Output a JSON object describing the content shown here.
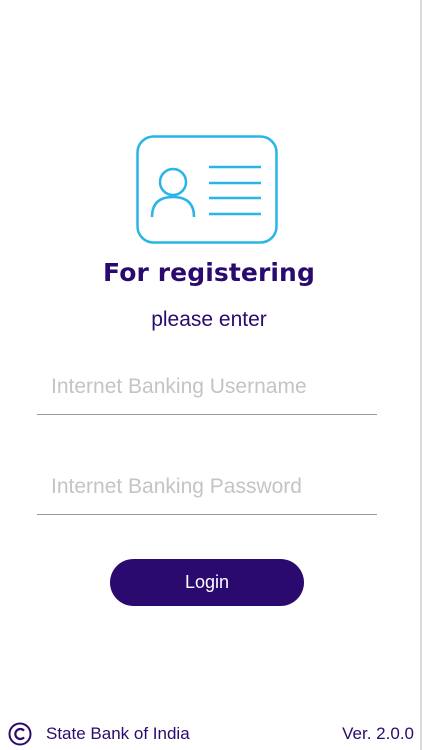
{
  "header": {
    "title": "For registering",
    "subtitle": "please enter"
  },
  "form": {
    "username_placeholder": "Internet Banking Username",
    "password_placeholder": "Internet Banking Password",
    "login_label": "Login"
  },
  "footer": {
    "bank_name": "State Bank of India",
    "version": "Ver. 2.0.0"
  },
  "icons": {
    "id_card": "id-card-icon",
    "copyright": "copyright-icon"
  },
  "colors": {
    "primary": "#2a0a6e",
    "icon_accent": "#29b6e6",
    "placeholder": "#c4c4c4",
    "divider": "#9a9a9a"
  }
}
